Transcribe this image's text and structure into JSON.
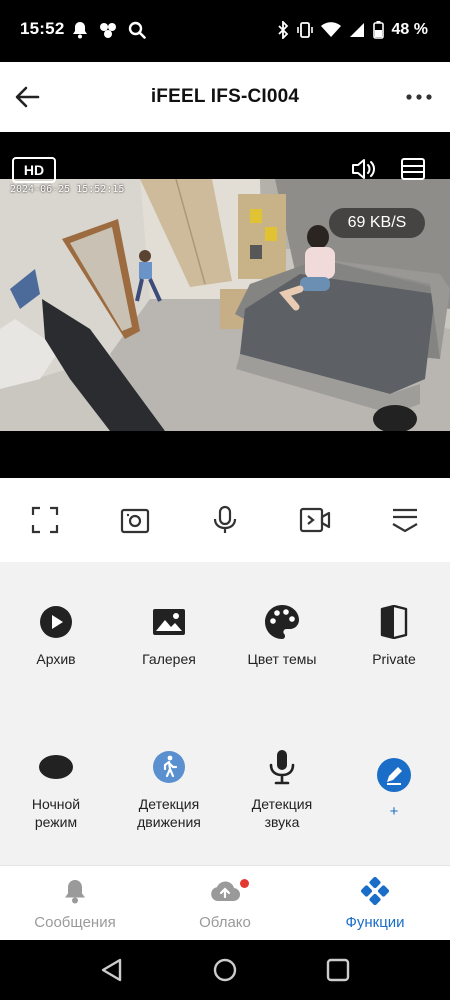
{
  "status_bar": {
    "time": "15:52",
    "battery": "48 %",
    "icons": [
      "bell-icon",
      "app-icon",
      "search-icon",
      "bluetooth-icon",
      "vibrate-icon",
      "wifi-icon",
      "signal-icon",
      "battery-icon"
    ]
  },
  "app_bar": {
    "title": "iFEEL IFS-CI004"
  },
  "video": {
    "quality_badge": "HD",
    "timestamp": "2024-06-25 15:52:15",
    "bitrate": "69 KB/S"
  },
  "controls": [
    "fullscreen-icon",
    "snapshot-icon",
    "microphone-icon",
    "record-icon",
    "collapse-icon"
  ],
  "functions": {
    "archive": "Архив",
    "gallery": "Галерея",
    "theme_color": "Цвет темы",
    "private": "Private",
    "night_mode": "Ночной\nрежим",
    "motion_detection": "Детекция\nдвижения",
    "sound_detection": "Детекция\nзвука",
    "add": "+"
  },
  "bottom_nav": {
    "messages": "Сообщения",
    "cloud": "Облако",
    "functions": "Функции"
  },
  "colors": {
    "accent": "#1a6ec8",
    "notification_dot": "#e23a32",
    "panel_bg": "#f2f2f2",
    "icon_dark": "#222222"
  }
}
